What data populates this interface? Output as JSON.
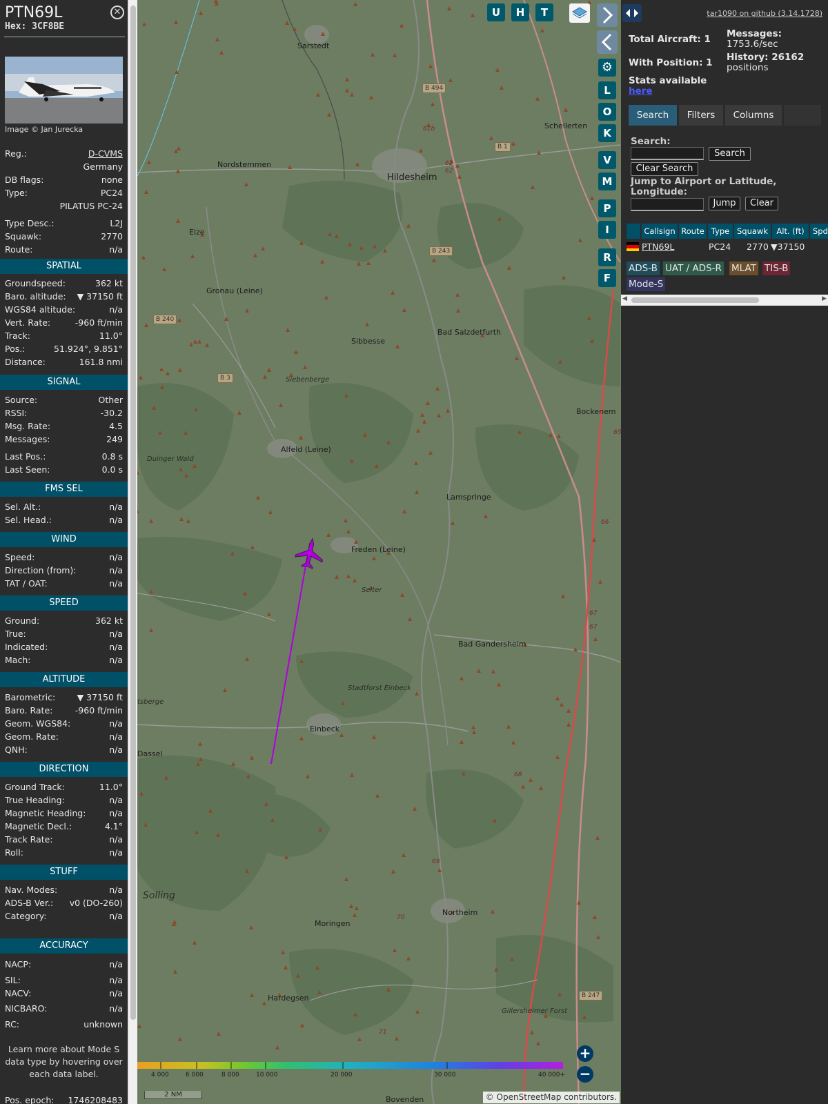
{
  "aircraft": {
    "callsign": "PTN69L",
    "hex": "Hex: 3CF8BE",
    "photo_caption": "Image © Jan Jurecka"
  },
  "details": [
    {
      "label": "Reg.:",
      "value": "D-CVMS",
      "link": true
    },
    {
      "label": "",
      "value": "Germany"
    },
    {
      "label": "DB flags:",
      "value": "none"
    },
    {
      "label": "Type:",
      "value": "PC24"
    },
    {
      "label": "",
      "value": "PILATUS PC-24"
    },
    {
      "label": "Type Desc.:",
      "value": "L2J"
    },
    {
      "label": "Squawk:",
      "value": "2770"
    },
    {
      "label": "Route:",
      "value": "n/a"
    }
  ],
  "sections": {
    "spatial": {
      "title": "SPATIAL",
      "rows": [
        {
          "label": "Groundspeed:",
          "value": "362 kt"
        },
        {
          "label": "Baro. altitude:",
          "value": "▼ 37150 ft"
        },
        {
          "label": "WGS84 altitude:",
          "value": "n/a"
        },
        {
          "label": "Vert. Rate:",
          "value": "-960 ft/min"
        },
        {
          "label": "Track:",
          "value": "11.0°"
        },
        {
          "label": "Pos.:",
          "value": "51.924°, 9.851°"
        },
        {
          "label": "Distance:",
          "value": "161.8 nmi"
        }
      ]
    },
    "signal": {
      "title": "SIGNAL",
      "rows": [
        {
          "label": "Source:",
          "value": "Other"
        },
        {
          "label": "RSSI:",
          "value": "-30.2"
        },
        {
          "label": "Msg. Rate:",
          "value": "4.5"
        },
        {
          "label": "Messages:",
          "value": "249"
        },
        {
          "label": "Last Pos.:",
          "value": "0.8 s"
        },
        {
          "label": "Last Seen:",
          "value": "0.0 s"
        }
      ]
    },
    "fms": {
      "title": "FMS SEL",
      "rows": [
        {
          "label": "Sel. Alt.:",
          "value": "n/a"
        },
        {
          "label": "Sel. Head.:",
          "value": "n/a"
        }
      ]
    },
    "wind": {
      "title": "WIND",
      "rows": [
        {
          "label": "Speed:",
          "value": "n/a"
        },
        {
          "label": "Direction (from):",
          "value": "n/a"
        },
        {
          "label": "TAT / OAT:",
          "value": "n/a"
        }
      ]
    },
    "speed": {
      "title": "SPEED",
      "rows": [
        {
          "label": "Ground:",
          "value": "362 kt"
        },
        {
          "label": "True:",
          "value": "n/a"
        },
        {
          "label": "Indicated:",
          "value": "n/a"
        },
        {
          "label": "Mach:",
          "value": "n/a"
        }
      ]
    },
    "altitude": {
      "title": "ALTITUDE",
      "rows": [
        {
          "label": "Barometric:",
          "value": "▼ 37150 ft"
        },
        {
          "label": "Baro. Rate:",
          "value": "-960 ft/min"
        },
        {
          "label": "Geom. WGS84:",
          "value": "n/a"
        },
        {
          "label": "Geom. Rate:",
          "value": "n/a"
        },
        {
          "label": "QNH:",
          "value": "n/a"
        }
      ]
    },
    "direction": {
      "title": "DIRECTION",
      "rows": [
        {
          "label": "Ground Track:",
          "value": "11.0°"
        },
        {
          "label": "True Heading:",
          "value": "n/a"
        },
        {
          "label": "Magnetic Heading:",
          "value": "n/a"
        },
        {
          "label": "Magnetic Decl.:",
          "value": "4.1°"
        },
        {
          "label": "Track Rate:",
          "value": "n/a"
        },
        {
          "label": "Roll:",
          "value": "n/a"
        }
      ]
    },
    "stuff": {
      "title": "STUFF",
      "rows": [
        {
          "label": "Nav. Modes:",
          "value": "n/a"
        },
        {
          "label": "ADS-B Ver.:",
          "value": "v0 (DO-260)"
        },
        {
          "label": "Category:",
          "value": "n/a"
        }
      ]
    },
    "accuracy": {
      "title": "ACCURACY",
      "rows": [
        {
          "label": "NACP:",
          "value": "n/a"
        },
        {
          "label": "SIL:",
          "value": "n/a"
        },
        {
          "label": "NACV:",
          "value": "n/a"
        },
        {
          "label": "NICBARO:",
          "value": "n/a"
        },
        {
          "label": "RC:",
          "value": "unknown"
        }
      ]
    }
  },
  "note": "Learn more about Mode S data type by hovering over each data label.",
  "pos_epoch": {
    "label": "Pos. epoch:",
    "value": "1746208483"
  },
  "map": {
    "labels": [
      {
        "text": "Sarstedt",
        "italic": false
      },
      {
        "text": "Schellerten",
        "italic": false
      },
      {
        "text": "Nordstemmen",
        "italic": false
      },
      {
        "text": "Hildesheim",
        "italic": false
      },
      {
        "text": "Elze",
        "italic": false
      },
      {
        "text": "Gronau (Leine)",
        "italic": false
      },
      {
        "text": "Bad Salzdetfurth",
        "italic": false
      },
      {
        "text": "Sibbesse",
        "italic": false
      },
      {
        "text": "Siebenberge",
        "italic": true
      },
      {
        "text": "Bockenem",
        "italic": false
      },
      {
        "text": "Alfeld (Leine)",
        "italic": false
      },
      {
        "text": "Duinger Wald",
        "italic": true
      },
      {
        "text": "Lamspringe",
        "italic": false
      },
      {
        "text": "Freden (Leine)",
        "italic": false
      },
      {
        "text": "Selter",
        "italic": true
      },
      {
        "text": "Bad Gandersheim",
        "italic": false
      },
      {
        "text": "Stadtforst Einbeck",
        "italic": true
      },
      {
        "text": "Einbeck",
        "italic": false
      },
      {
        "text": "Dassel",
        "italic": false
      },
      {
        "text": "tsberge",
        "italic": true
      },
      {
        "text": "Solling",
        "italic": true
      },
      {
        "text": "Northeim",
        "italic": false
      },
      {
        "text": "Moringen",
        "italic": false
      },
      {
        "text": "Hardegsen",
        "italic": false
      },
      {
        "text": "Gillersheimer Forst",
        "italic": true
      },
      {
        "text": "Bovenden",
        "italic": false
      }
    ],
    "roads": [
      "B 494",
      "B 1",
      "B 243",
      "B 240",
      "B 3",
      "B 247"
    ],
    "road_numbers": [
      "61b",
      "62",
      "62",
      "65",
      "66",
      "67",
      "67",
      "68",
      "69",
      "70",
      "71"
    ],
    "altitude_scale": [
      "4 000",
      "6 000",
      "8 000",
      "10 000",
      "20 000",
      "30 000",
      "40 000+"
    ],
    "scale_bar": "2 NM",
    "attribution_prefix": "© ",
    "attribution_link": "OpenStreetMap",
    "attribution_suffix": " contributors.",
    "track_color": "#b000e0",
    "aircraft_color": "#b000e0"
  },
  "map_buttons": [
    "U",
    "H",
    "T"
  ],
  "side_buttons": [
    "L",
    "O",
    "K",
    "V",
    "M",
    "P",
    "I",
    "R",
    "F"
  ],
  "right": {
    "version": "tar1090 on github (3.14.1728)",
    "total_label": "Total Aircraft: 1",
    "with_pos_label": "With Position: 1",
    "messages_label": "Messages:",
    "messages_value": "1753.6/sec",
    "history_label": "History: 26162",
    "history_value": "positions",
    "stats_label": "Stats available",
    "stats_link": "here",
    "tabs": [
      "Search",
      "Filters",
      "Columns"
    ],
    "search_label": "Search:",
    "search_button": "Search",
    "clear_search": "Clear Search",
    "jump_label": "Jump to Airport or Latitude, Longitude:",
    "jump_button": "Jump",
    "clear_button": "Clear",
    "table_headers": [
      "Callsign",
      "Route",
      "Type",
      "Squawk",
      "Alt. (ft)",
      "Spd"
    ],
    "table_row": {
      "callsign": "PTN69L",
      "route": "",
      "type": "PC24",
      "squawk": "2770",
      "alt": "▼37150"
    },
    "legend": [
      "ADS-B",
      "UAT / ADS-R",
      "MLAT",
      "TIS-B",
      "Mode-S"
    ]
  },
  "colors": {
    "section_header": "#005068",
    "adsb": "#1f4d5c",
    "uat": "#2f5a4a",
    "mlat": "#6b4f2a",
    "tisb": "#6b2634",
    "modes": "#33355f"
  }
}
